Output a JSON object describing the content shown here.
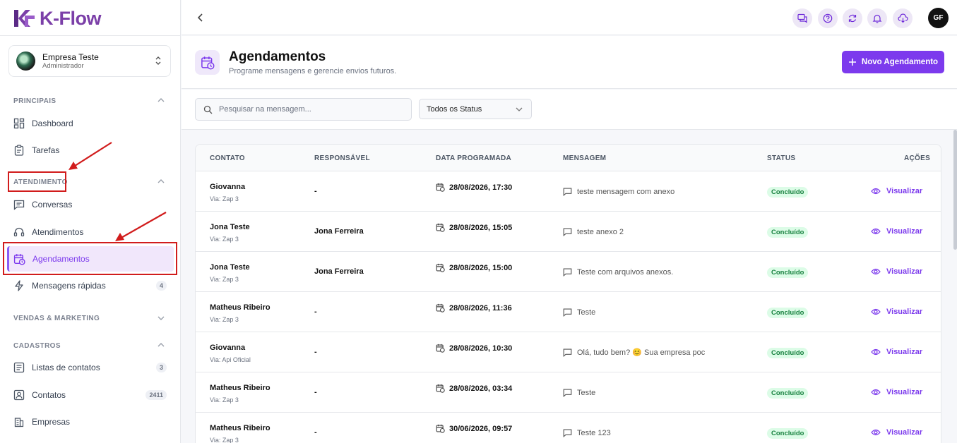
{
  "brand": {
    "name": "K-Flow",
    "accent": "#7c3aed"
  },
  "company": {
    "name": "Empresa Teste",
    "role": "Administrador"
  },
  "sidebar": {
    "sections": [
      {
        "label": "PRINCIPAIS"
      },
      {
        "label": "ATENDIMENTO"
      },
      {
        "label": "VENDAS & MARKETING"
      },
      {
        "label": "CADASTROS"
      }
    ],
    "items": [
      {
        "label": "Dashboard",
        "icon": "dashboard-icon"
      },
      {
        "label": "Tarefas",
        "icon": "clipboard-icon"
      },
      {
        "label": "Conversas",
        "icon": "chat-icon"
      },
      {
        "label": "Atendimentos",
        "icon": "headset-icon"
      },
      {
        "label": "Agendamentos",
        "icon": "calendar-clock-icon",
        "active": true
      },
      {
        "label": "Mensagens rápidas",
        "icon": "bolt-icon",
        "badge": "4"
      },
      {
        "label": "Listas de contatos",
        "icon": "list-icon",
        "badge": "3"
      },
      {
        "label": "Contatos",
        "icon": "contact-icon",
        "badge": "2411"
      },
      {
        "label": "Empresas",
        "icon": "building-icon"
      }
    ]
  },
  "topbar": {
    "user_initials": "GF"
  },
  "page": {
    "title": "Agendamentos",
    "subtitle": "Programe mensagens e gerencie envios futuros.",
    "new_button": "Novo Agendamento"
  },
  "filters": {
    "search_placeholder": "Pesquisar na mensagem...",
    "status_value": "Todos os Status"
  },
  "table": {
    "columns": [
      "CONTATO",
      "RESPONSÁVEL",
      "DATA PROGRAMADA",
      "MENSAGEM",
      "STATUS",
      "AÇÕES"
    ],
    "rows": [
      {
        "name": "Giovanna",
        "via": "Via: Zap 3",
        "resp": "-",
        "date": "28/08/2026, 17:30",
        "msg": "teste mensagem com anexo",
        "status": "Concluído",
        "action": "Visualizar"
      },
      {
        "name": "Jona Teste",
        "via": "Via: Zap 3",
        "resp": "Jona Ferreira",
        "date": "28/08/2026, 15:05",
        "msg": "teste anexo 2",
        "status": "Concluído",
        "action": "Visualizar"
      },
      {
        "name": "Jona Teste",
        "via": "Via: Zap 3",
        "resp": "Jona Ferreira",
        "date": "28/08/2026, 15:00",
        "msg": "Teste com arquivos anexos.",
        "status": "Concluído",
        "action": "Visualizar"
      },
      {
        "name": "Matheus Ribeiro",
        "via": "Via: Zap 3",
        "resp": "-",
        "date": "28/08/2026, 11:36",
        "msg": "Teste",
        "status": "Concluído",
        "action": "Visualizar"
      },
      {
        "name": "Giovanna",
        "via": "Via: Api Oficial",
        "resp": "-",
        "date": "28/08/2026, 10:30",
        "msg": "Olá, tudo bem? 😊 Sua empresa poc",
        "status": "Concluído",
        "action": "Visualizar"
      },
      {
        "name": "Matheus Ribeiro",
        "via": "Via: Zap 3",
        "resp": "-",
        "date": "28/08/2026, 03:34",
        "msg": "Teste",
        "status": "Concluído",
        "action": "Visualizar"
      },
      {
        "name": "Matheus Ribeiro",
        "via": "Via: Zap 3",
        "resp": "-",
        "date": "30/06/2026, 09:57",
        "msg": "Teste 123",
        "status": "Concluído",
        "action": "Visualizar"
      }
    ]
  }
}
